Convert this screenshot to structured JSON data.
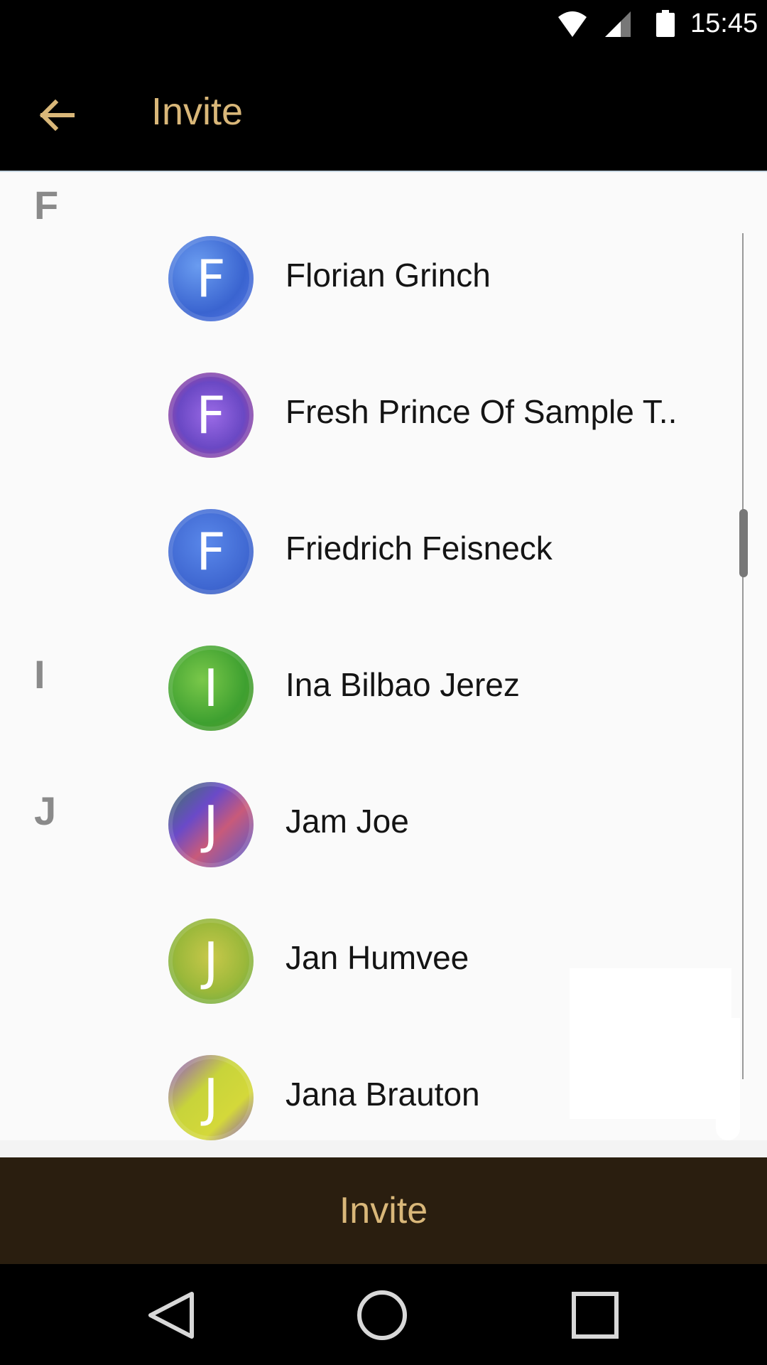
{
  "status_bar": {
    "time": "15:45",
    "icons": [
      "wifi-icon",
      "signal-icon",
      "battery-icon"
    ]
  },
  "app_bar": {
    "title": "Invite",
    "back_icon": "arrow-left-icon",
    "accent_color": "#d9b779"
  },
  "sections": [
    "F",
    "I",
    "J"
  ],
  "contacts": [
    {
      "initial": "F",
      "name": "Florian Grinch",
      "section": "F",
      "color": "#4a7ae0"
    },
    {
      "initial": "F",
      "name": "Fresh Prince Of Sample T..",
      "section": "F",
      "color": "#7a52c8"
    },
    {
      "initial": "F",
      "name": "Friedrich Feisneck",
      "section": "F",
      "color": "#4a72d4"
    },
    {
      "initial": "I",
      "name": "Ina Bilbao Jerez",
      "section": "I",
      "color": "#4aa83a"
    },
    {
      "initial": "J",
      "name": "Jam Joe",
      "section": "J",
      "color": "#6a4aa8"
    },
    {
      "initial": "J",
      "name": "Jan Humvee",
      "section": "J",
      "color": "#a8b83a"
    },
    {
      "initial": "J",
      "name": "Jana Brauton",
      "section": "J",
      "color": "#c8d43a"
    }
  ],
  "invite_button": {
    "label": "Invite",
    "background": "#2a1e0f"
  },
  "nav_bar": {
    "icons": [
      "nav-back-icon",
      "nav-home-icon",
      "nav-recents-icon"
    ]
  }
}
